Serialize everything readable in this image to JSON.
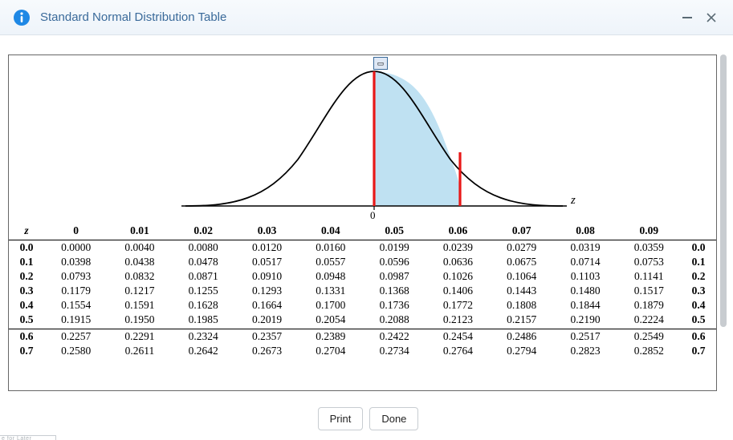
{
  "title": "Standard Normal Distribution Table",
  "axis": {
    "z_label": "z",
    "zero_label": "0"
  },
  "table_header": [
    "z",
    "0",
    "0.01",
    "0.02",
    "0.03",
    "0.04",
    "0.05",
    "0.06",
    "0.07",
    "0.08",
    "0.09"
  ],
  "table_rows": [
    {
      "z": "0.0",
      "v": [
        "0.0000",
        "0.0040",
        "0.0080",
        "0.0120",
        "0.0160",
        "0.0199",
        "0.0239",
        "0.0279",
        "0.0319",
        "0.0359"
      ]
    },
    {
      "z": "0.1",
      "v": [
        "0.0398",
        "0.0438",
        "0.0478",
        "0.0517",
        "0.0557",
        "0.0596",
        "0.0636",
        "0.0675",
        "0.0714",
        "0.0753"
      ]
    },
    {
      "z": "0.2",
      "v": [
        "0.0793",
        "0.0832",
        "0.0871",
        "0.0910",
        "0.0948",
        "0.0987",
        "0.1026",
        "0.1064",
        "0.1103",
        "0.1141"
      ]
    },
    {
      "z": "0.3",
      "v": [
        "0.1179",
        "0.1217",
        "0.1255",
        "0.1293",
        "0.1331",
        "0.1368",
        "0.1406",
        "0.1443",
        "0.1480",
        "0.1517"
      ]
    },
    {
      "z": "0.4",
      "v": [
        "0.1554",
        "0.1591",
        "0.1628",
        "0.1664",
        "0.1700",
        "0.1736",
        "0.1772",
        "0.1808",
        "0.1844",
        "0.1879"
      ]
    },
    {
      "z": "0.5",
      "v": [
        "0.1915",
        "0.1950",
        "0.1985",
        "0.2019",
        "0.2054",
        "0.2088",
        "0.2123",
        "0.2157",
        "0.2190",
        "0.2224"
      ],
      "group_end": true
    },
    {
      "z": "0.6",
      "v": [
        "0.2257",
        "0.2291",
        "0.2324",
        "0.2357",
        "0.2389",
        "0.2422",
        "0.2454",
        "0.2486",
        "0.2517",
        "0.2549"
      ]
    },
    {
      "z": "0.7",
      "v": [
        "0.2580",
        "0.2611",
        "0.2642",
        "0.2673",
        "0.2704",
        "0.2734",
        "0.2764",
        "0.2794",
        "0.2823",
        "0.2852"
      ]
    }
  ],
  "buttons": {
    "print": "Print",
    "done": "Done"
  },
  "bottom_label_fragment": "e for Later"
}
